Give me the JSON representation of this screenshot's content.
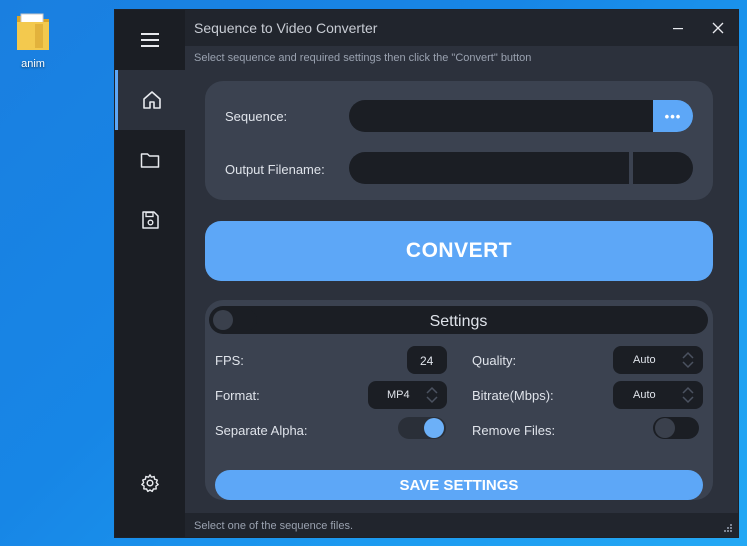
{
  "desktop": {
    "icon_label": "anim"
  },
  "window": {
    "title": "Sequence to Video Converter",
    "subtitle": "Select sequence and required settings then click the \"Convert\" button",
    "status": "Select one of the sequence files."
  },
  "sidebar": {
    "items": [
      {
        "icon": "menu-icon"
      },
      {
        "icon": "home-icon",
        "active": true
      },
      {
        "icon": "folder-icon"
      },
      {
        "icon": "save-icon"
      },
      {
        "icon": "gear-icon"
      }
    ]
  },
  "form": {
    "sequence_label": "Sequence:",
    "sequence_value": "",
    "browse_label": "•••",
    "output_label": "Output Filename:",
    "output_value": "",
    "extension_value": ""
  },
  "convert_label": "CONVERT",
  "settings": {
    "title": "Settings",
    "fps_label": "FPS:",
    "fps_value": "24",
    "quality_label": "Quality:",
    "quality_value": "Auto",
    "format_label": "Format:",
    "format_value": "MP4",
    "bitrate_label": "Bitrate(Mbps):",
    "bitrate_value": "Auto",
    "separate_alpha_label": "Separate Alpha:",
    "separate_alpha": true,
    "remove_files_label": "Remove Files:",
    "remove_files": false,
    "settings_toggle": false,
    "save_label": "SAVE SETTINGS"
  },
  "colors": {
    "accent": "#5da7f7",
    "window_bg": "#2c313c",
    "panel_bg": "#3b4250",
    "field_bg": "#1b1e24"
  }
}
